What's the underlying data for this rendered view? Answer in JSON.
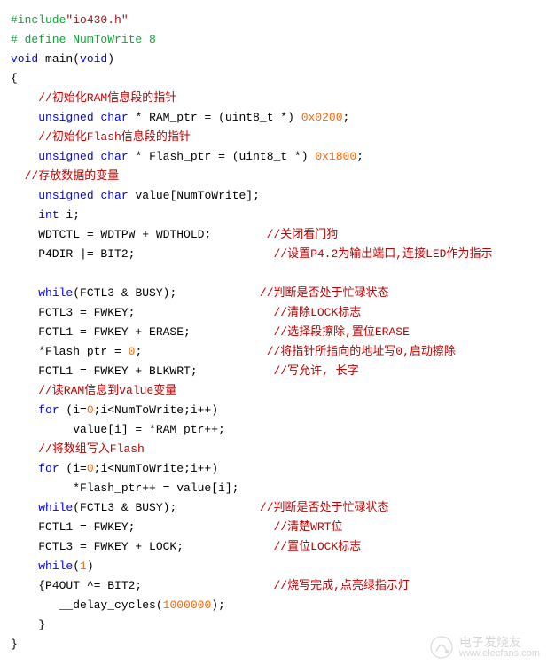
{
  "code": {
    "l1": {
      "inc1": "#include",
      "inc2": "\"io430.h\""
    },
    "l2": {
      "def": "# define NumToWrite 8"
    },
    "l3": {
      "kw1": "void",
      "ident": " main(",
      "kw2": "void",
      "rest": ")"
    },
    "l4": "{",
    "l5": "    //初始化RAM信息段的指针",
    "l6": {
      "pre": "    ",
      "kw1": "unsigned",
      "sp1": " ",
      "kw2": "char",
      "mid": " * RAM_ptr = (uint8_t *) ",
      "num": "0x0200",
      "end": ";"
    },
    "l7": "    //初始化Flash信息段的指针",
    "l8": {
      "pre": "    ",
      "kw1": "unsigned",
      "sp1": " ",
      "kw2": "char",
      "mid": " * Flash_ptr = (uint8_t *) ",
      "num": "0x1800",
      "end": ";"
    },
    "l9": "  //存放数据的变量",
    "l10": {
      "pre": "    ",
      "kw1": "unsigned",
      "sp1": " ",
      "kw2": "char",
      "end": " value[NumToWrite];"
    },
    "l11": {
      "pre": "    ",
      "kw": "int",
      "end": " i;"
    },
    "l12": {
      "code": "    WDTCTL = WDTPW + WDTHOLD;",
      "pad": "        ",
      "cmt": "//关闭看门狗"
    },
    "l13": {
      "code": "    P4DIR |= BIT2;",
      "pad": "                    ",
      "cmt": "//设置P4.2为输出端口,连接LED作为指示"
    },
    "l14": "",
    "l15": {
      "pre": "    ",
      "kw": "while",
      "code": "(FCTL3 & BUSY);",
      "pad": "            ",
      "cmt": "//判断是否处于忙碌状态"
    },
    "l16": {
      "code": "    FCTL3 = FWKEY;",
      "pad": "                    ",
      "cmt": "//清除LOCK标志"
    },
    "l17": {
      "code": "    FCTL1 = FWKEY + ERASE;",
      "pad": "            ",
      "cmt": "//选择段擦除,置位ERASE"
    },
    "l18": {
      "code": "    *Flash_ptr = ",
      "num": "0",
      "end": ";",
      "pad": "                  ",
      "cmt": "//将指针所指向的地址写0,启动擦除"
    },
    "l19": {
      "code": "    FCTL1 = FWKEY + BLKWRT;",
      "pad": "           ",
      "cmt": "//写允许, 长字"
    },
    "l20": "    //读RAM信息到value变量",
    "l21": {
      "pre": "    ",
      "kw": "for",
      "mid": " (i=",
      "n1": "0",
      "rest": ";i<NumToWrite;i++)"
    },
    "l22": "         value[i] = *RAM_ptr++;",
    "l23": "    //将数组写入Flash",
    "l24": {
      "pre": "    ",
      "kw": "for",
      "mid": " (i=",
      "n1": "0",
      "rest": ";i<NumToWrite;i++)"
    },
    "l25": "         *Flash_ptr++ = value[i];",
    "l26": {
      "pre": "    ",
      "kw": "while",
      "code": "(FCTL3 & BUSY);",
      "pad": "            ",
      "cmt": "//判断是否处于忙碌状态"
    },
    "l27": {
      "code": "    FCTL1 = FWKEY;",
      "pad": "                    ",
      "cmt": "//清楚WRT位"
    },
    "l28": {
      "code": "    FCTL3 = FWKEY + LOCK;",
      "pad": "             ",
      "cmt": "//置位LOCK标志"
    },
    "l29": {
      "pre": "    ",
      "kw": "while",
      "mid": "(",
      "num": "1",
      "end": ")"
    },
    "l30": {
      "code": "    {P4OUT ^= BIT2;",
      "pad": "                   ",
      "cmt": "//烧写完成,点亮绿指示灯"
    },
    "l31": {
      "code": "       __delay_cycles(",
      "num": "1000000",
      "end": ");"
    },
    "l32": "    }",
    "l33": "}"
  },
  "watermark": {
    "brand": "电子发烧友",
    "url": "www.elecfans.com"
  }
}
